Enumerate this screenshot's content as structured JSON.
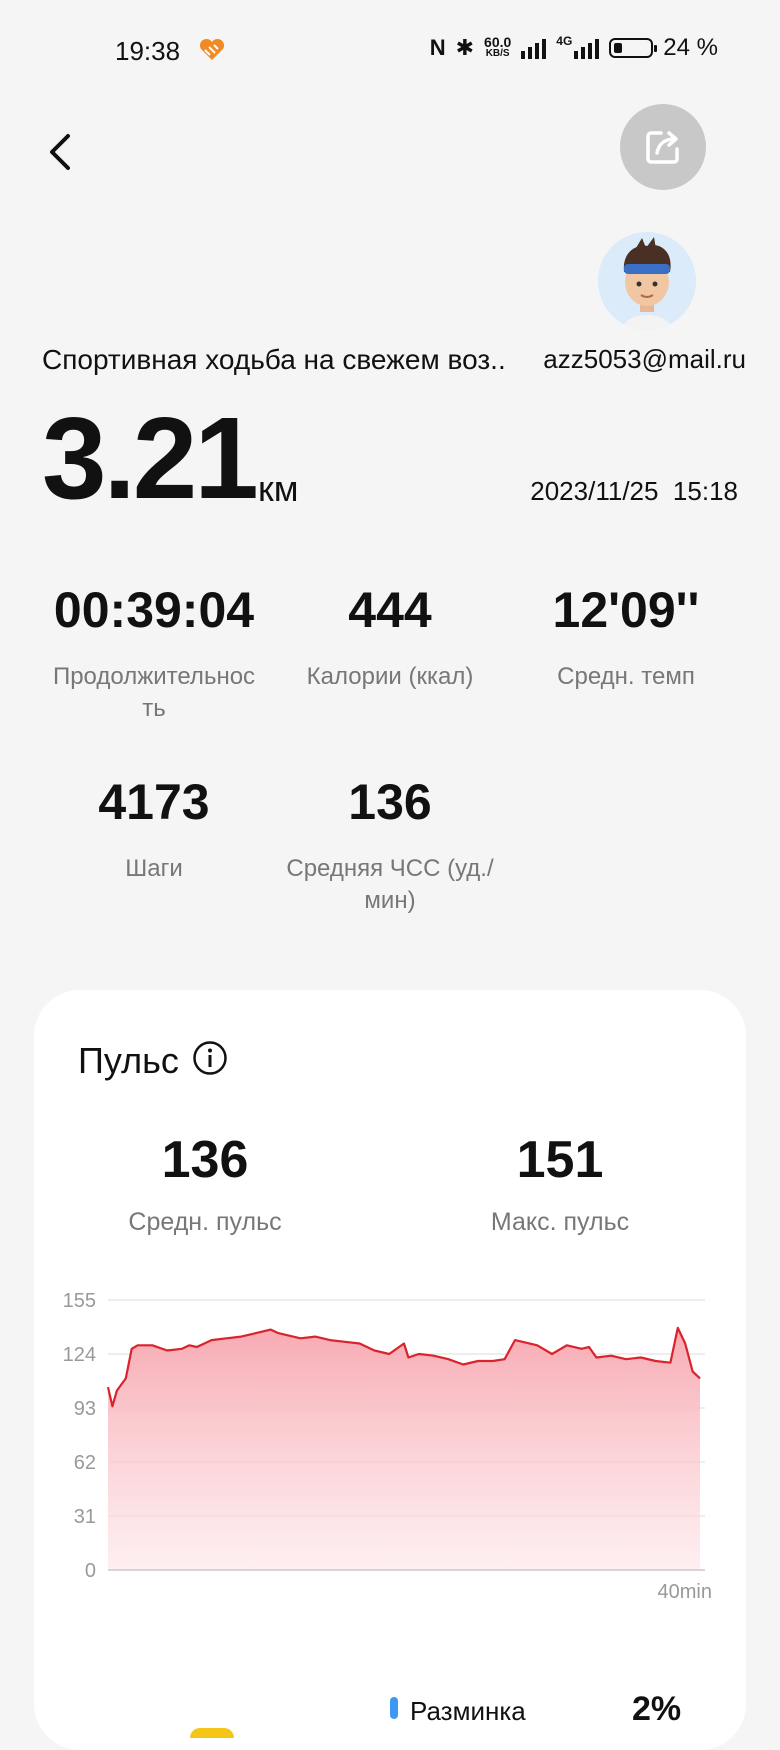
{
  "status_bar": {
    "time": "19:38",
    "nfc": "N",
    "bluetooth": "✱",
    "speed_value": "60.0",
    "speed_unit": "KB/S",
    "network": "4G",
    "battery": "24 %"
  },
  "header": {
    "back_icon": "chevron-left-icon",
    "share_icon": "share-icon"
  },
  "workout": {
    "title": "Спортивная ходьба на свежем воз..",
    "email": "azz5053@mail.ru",
    "distance": "3.21",
    "distance_unit": "км",
    "date": "2023/11/25",
    "time": "15:18"
  },
  "stats": [
    {
      "value": "00:39:04",
      "label": "Продолжительнос\nть"
    },
    {
      "value": "444",
      "label": "Калории (ккал)"
    },
    {
      "value": "12'09''",
      "label": "Средн. темп"
    },
    {
      "value": "4173",
      "label": "Шаги"
    },
    {
      "value": "136",
      "label": "Средняя ЧСС (уд./\nмин)"
    }
  ],
  "pulse": {
    "title": "Пульс",
    "avg_value": "136",
    "avg_label": "Средн. пульс",
    "max_value": "151",
    "max_label": "Макс. пульс"
  },
  "chart_data": {
    "type": "area",
    "y_ticks": [
      "155",
      "124",
      "93",
      "62",
      "31",
      "0"
    ],
    "ylim": [
      0,
      155
    ],
    "xlim": [
      0,
      40
    ],
    "x_end_label": "40min",
    "line_color": "#d9232d",
    "fill_color": "#f8a8b0",
    "grid": true,
    "x": [
      0,
      0.3,
      0.6,
      1.2,
      1.6,
      2,
      3,
      4,
      5,
      5.5,
      6,
      7,
      8,
      9,
      10,
      11,
      11.5,
      12,
      13,
      14,
      15,
      16,
      17,
      18,
      19,
      20,
      20.3,
      21,
      22,
      23,
      24,
      25,
      26,
      26.8,
      27.5,
      28,
      29,
      30,
      31,
      32,
      32.5,
      33,
      34,
      35,
      36,
      37,
      38,
      38.5,
      39,
      39.5,
      40
    ],
    "y": [
      105,
      94,
      103,
      110,
      127,
      129,
      129,
      126,
      127,
      129,
      128,
      132,
      133,
      134,
      136,
      138,
      136,
      135,
      133,
      134,
      132,
      131,
      130,
      126,
      124,
      130,
      122,
      124,
      123,
      121,
      118,
      120,
      120,
      121,
      132,
      131,
      129,
      124,
      129,
      127,
      128,
      122,
      123,
      121,
      122,
      120,
      119,
      139,
      130,
      114,
      110
    ]
  },
  "zones": [
    {
      "label": "Разминка",
      "value": "2%",
      "color": "#3d98f5"
    }
  ]
}
